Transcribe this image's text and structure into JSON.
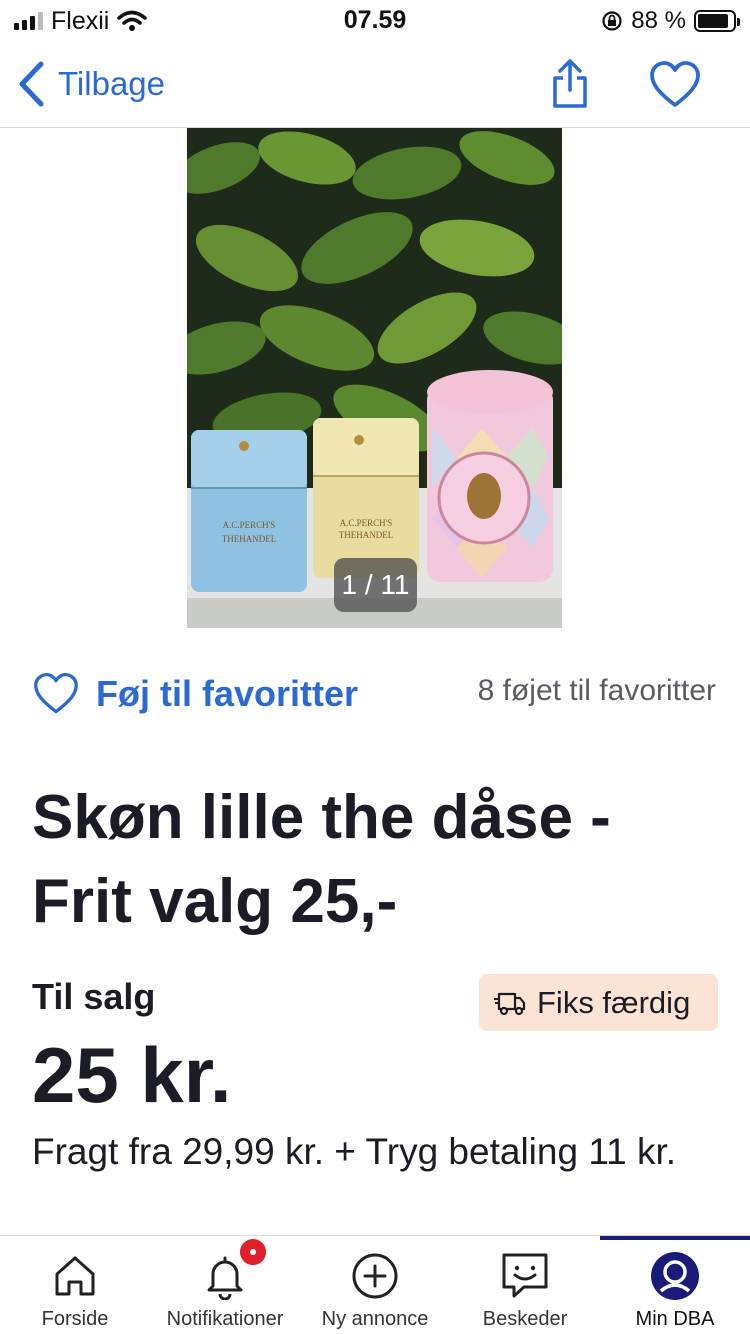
{
  "status_bar": {
    "carrier": "Flexii",
    "time": "07.59",
    "battery_text": "88 %",
    "battery_level": 0.88
  },
  "nav": {
    "back_label": "Tilbage",
    "icons": [
      "chevron-left-icon",
      "share-icon",
      "heart-icon"
    ]
  },
  "gallery": {
    "counter": "1 / 11",
    "current": 1,
    "total": 11
  },
  "favorites": {
    "add_label": "Føj til favoritter",
    "count_text": "8 føjet til favoritter"
  },
  "ad": {
    "title": "Skøn lille the dåse - Frit valg 25,-",
    "sale_type": "Til salg",
    "shipping_badge": "Fiks færdig",
    "price": "25 kr.",
    "shipping_info": "Fragt fra 29,99 kr. + Tryg betaling 11 kr."
  },
  "tabs": [
    {
      "label": "Forside",
      "icon": "home-icon"
    },
    {
      "label": "Notifikationer",
      "icon": "bell-icon"
    },
    {
      "label": "Ny annonce",
      "icon": "plus-circle-icon"
    },
    {
      "label": "Beskeder",
      "icon": "chat-icon"
    },
    {
      "label": "Min DBA",
      "icon": "profile-icon",
      "active": true
    }
  ],
  "colors": {
    "accent_blue": "#2a6ad2",
    "active_tab": "#1b1b7a",
    "badge_red": "#e01f2a",
    "shipping_badge_bg": "#fbe3d6"
  }
}
